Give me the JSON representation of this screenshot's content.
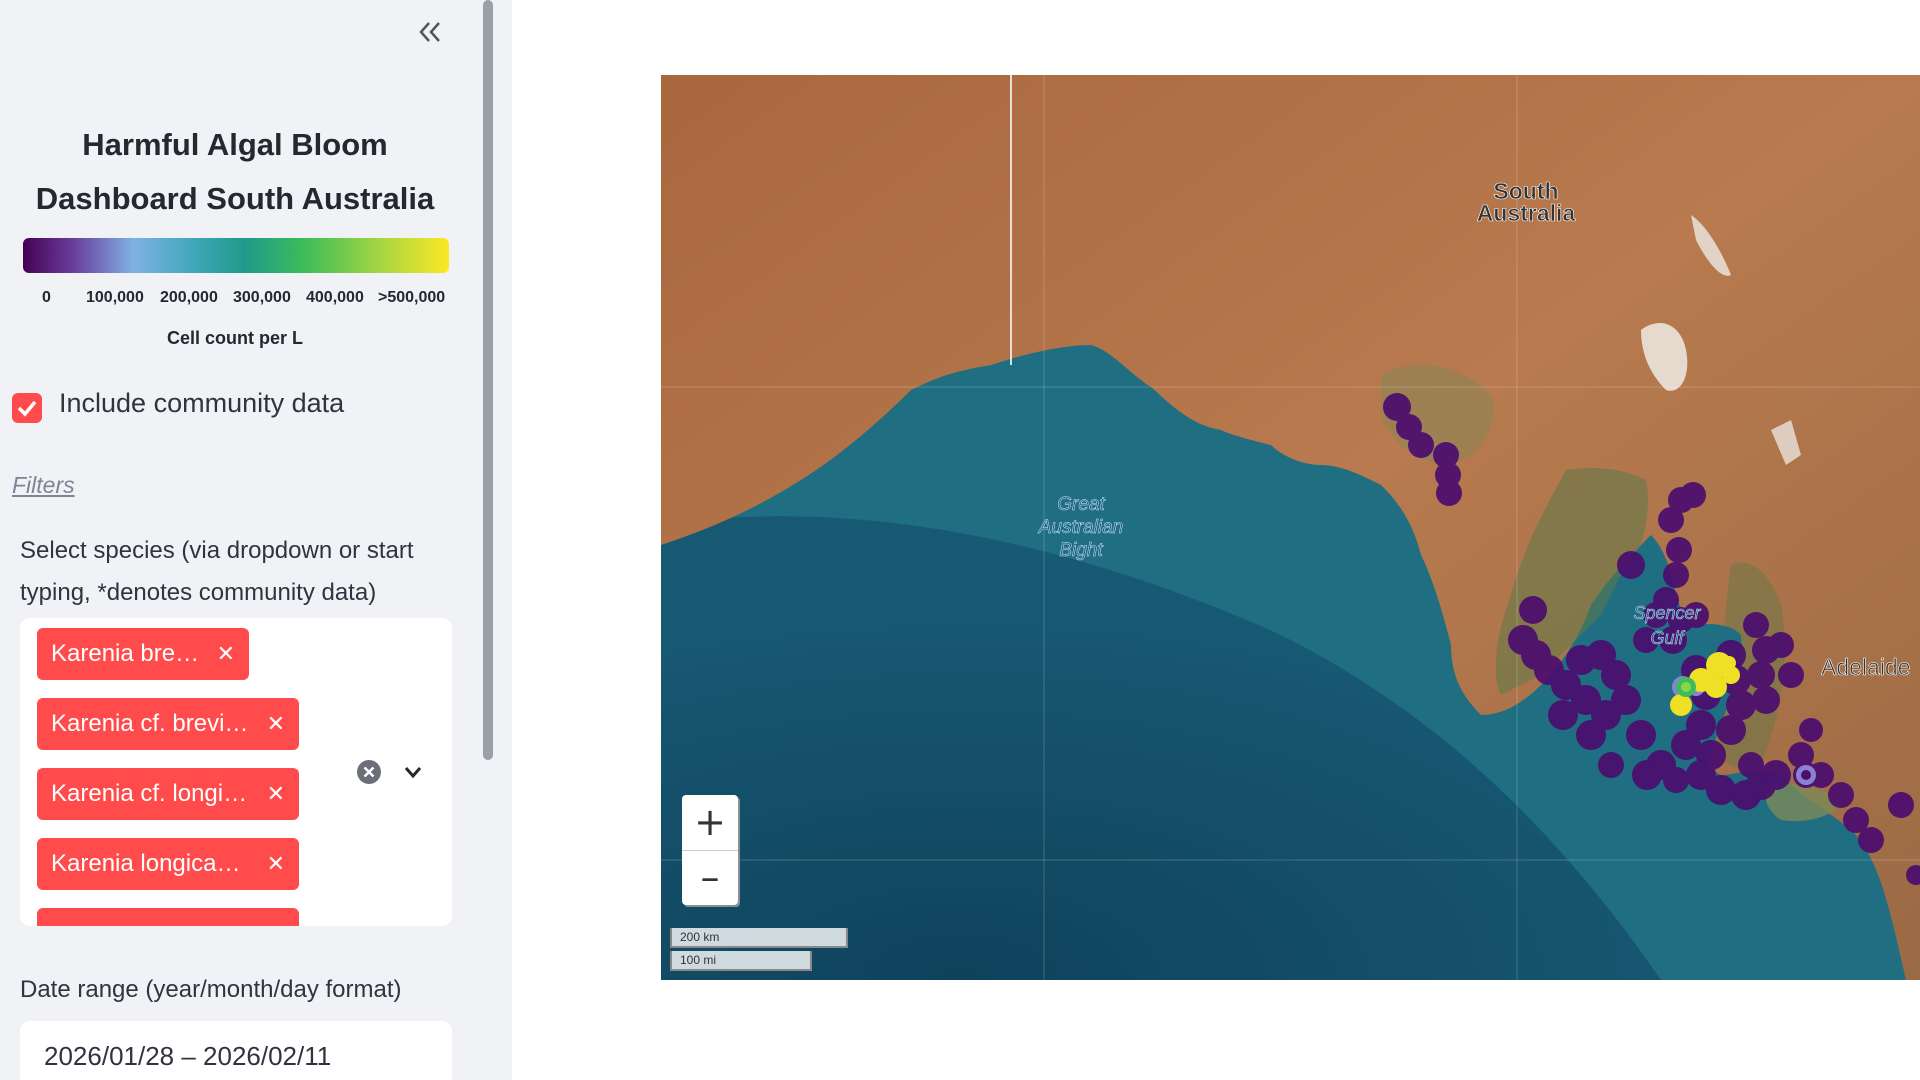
{
  "sidebar": {
    "collapse_icon": "chevron-double-left-icon",
    "title_line1": "Harmful Algal Bloom",
    "title_line2": "Dashboard South Australia",
    "colorbar": {
      "ticks": [
        "0",
        "100,000",
        "200,000",
        "300,000",
        "400,000",
        ">500,000"
      ],
      "label": "Cell count per L",
      "colors": [
        "#440154",
        "#7fb2e3",
        "#1f9a8a",
        "#3cbc5a",
        "#fde725"
      ]
    },
    "community": {
      "checked": true,
      "label": "Include community data"
    },
    "filters_heading": "Filters",
    "species": {
      "label": "Select species (via dropdown or start typing, *denotes community data)",
      "selected": [
        "Karenia brevis",
        "Karenia cf. brevi…",
        "Karenia cf. longi…",
        "Karenia longica…"
      ]
    },
    "date": {
      "label": "Date range (year/month/day format)",
      "value": "2026/01/28 – 2026/02/11"
    }
  },
  "map": {
    "labels": {
      "region": "South Australia",
      "bight": "Great Australian Bight",
      "gulf": "Spencer Gulf",
      "city": "Adelaide"
    },
    "zoom_in": "+",
    "zoom_out": "–",
    "scale_km": "200 km",
    "scale_mi": "100 mi",
    "accent": "#ff4b4b"
  }
}
